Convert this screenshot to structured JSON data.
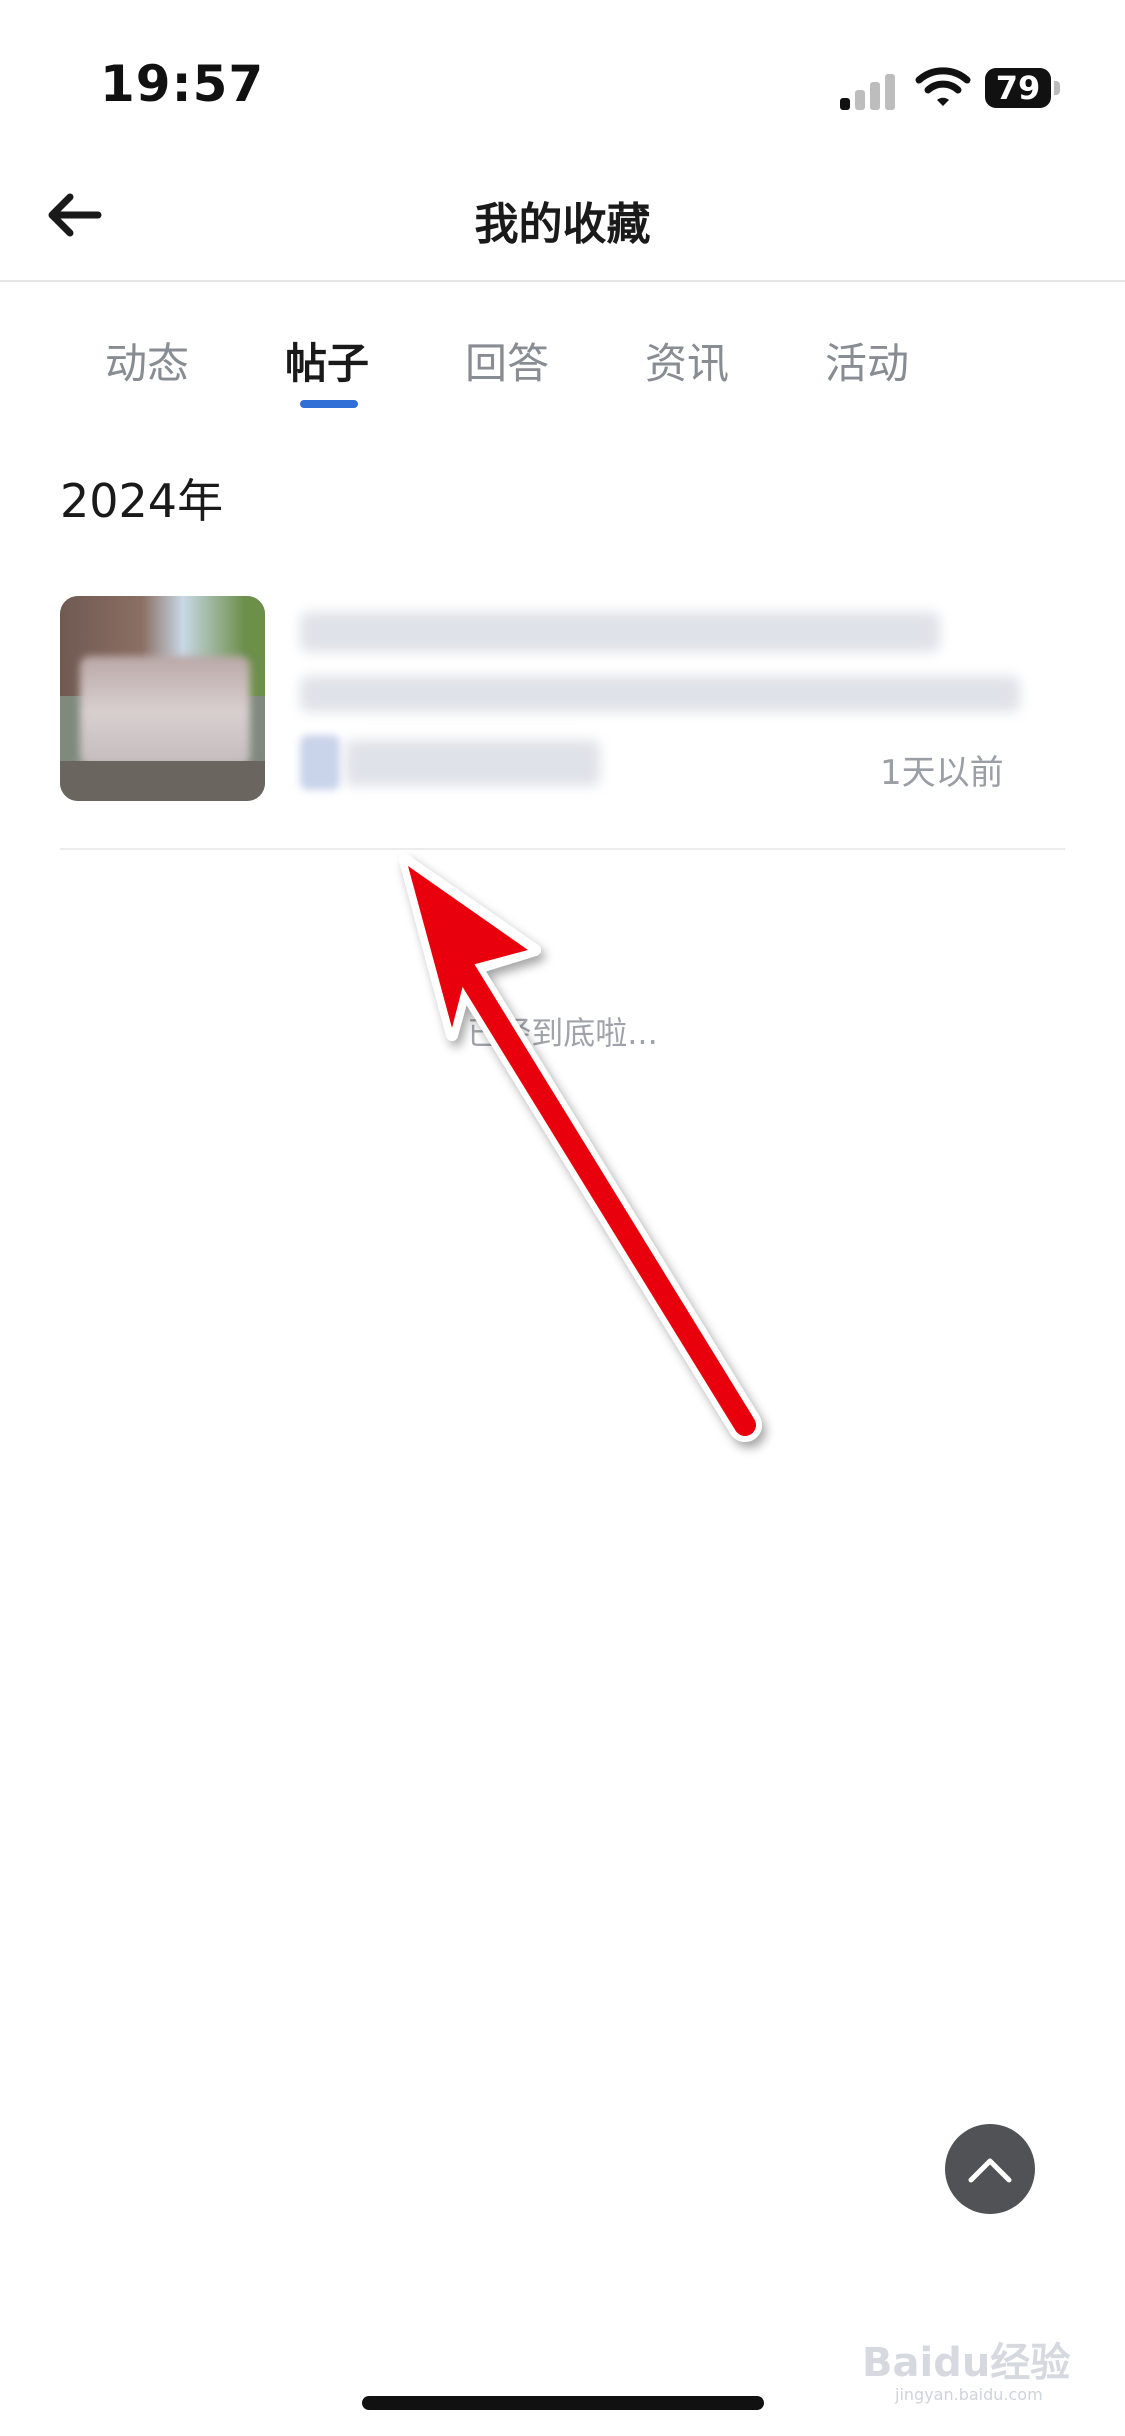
{
  "status_bar": {
    "time": "19:57",
    "battery": "79"
  },
  "nav": {
    "title": "我的收藏"
  },
  "tabs": [
    {
      "label": "动态",
      "active": false
    },
    {
      "label": "帖子",
      "active": true
    },
    {
      "label": "回答",
      "active": false
    },
    {
      "label": "资讯",
      "active": false
    },
    {
      "label": "活动",
      "active": false
    }
  ],
  "section": {
    "year": "2024年"
  },
  "items": [
    {
      "time": "1天以前"
    }
  ],
  "list_end": "已经到底啦...",
  "watermark": {
    "brand": "Baidu经验",
    "url": "jingyan.baidu.com"
  },
  "colors": {
    "accent": "#2f6fd6",
    "annotation_arrow": "#e8000b"
  },
  "icons": {
    "back": "arrow-left-icon",
    "to_top": "chevron-up-icon"
  }
}
